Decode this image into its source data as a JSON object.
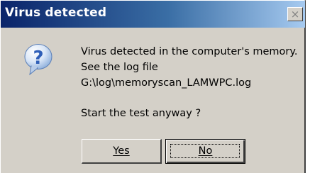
{
  "dialog": {
    "title": "Virus detected",
    "close_glyph": "×",
    "icon": "question-icon",
    "message_lines": [
      "Virus detected in the computer's memory.",
      "See the log file",
      "G:\\log\\memoryscan_LAMWPC.log"
    ],
    "prompt": "Start the test anyway ?",
    "buttons": {
      "yes_label": "Yes",
      "no_label": "No"
    }
  },
  "colors": {
    "titlebar_start": "#0a246a",
    "titlebar_end": "#a6caf0",
    "face": "#d4d0c8",
    "icon_blue": "#2f5fb8"
  }
}
